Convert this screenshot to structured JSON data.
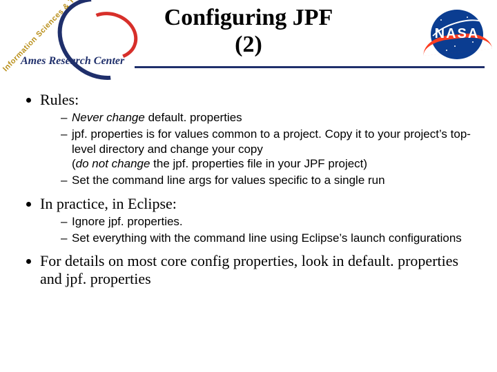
{
  "title_line1": "Configuring JPF",
  "title_line2": "(2)",
  "logos": {
    "nasa_word": "NASA",
    "ames_caption": "Ames Research Center",
    "ames_ist": "Information Sciences & Technology"
  },
  "bullets": {
    "b1": "Rules:",
    "b1_subs": {
      "s1_italic": "Never change",
      "s1_rest": " default. properties",
      "s2": "jpf. properties is for values common to a project.  Copy it to your project’s top-level directory and change your copy",
      "s2_paren_pre": "(",
      "s2_paren_italic": "do not change",
      "s2_paren_rest": " the jpf. properties file in your JPF project)",
      "s3": "Set the command line args for values specific to a single run"
    },
    "b2": "In practice, in Eclipse:",
    "b2_subs": {
      "s1": "Ignore jpf. properties.",
      "s2": "Set everything with the command line using Eclipse’s launch configurations"
    },
    "b3": "For details on most core config properties, look in default. properties and jpf. properties"
  }
}
